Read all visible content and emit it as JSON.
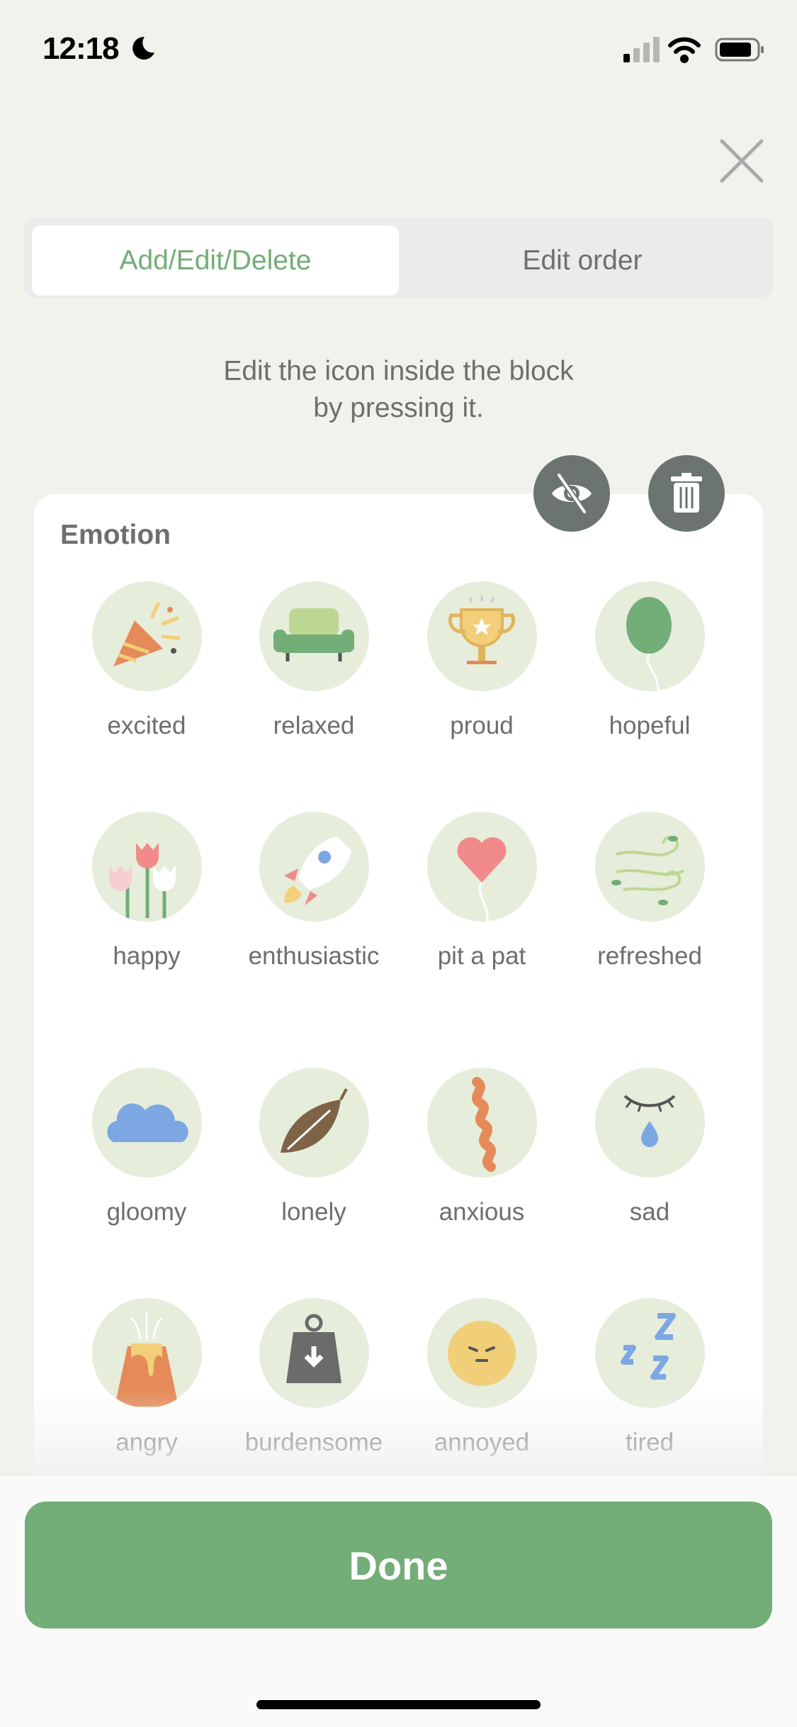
{
  "status_bar": {
    "time": "12:18",
    "icons": [
      "moon-icon",
      "signal-icon",
      "wifi-icon",
      "battery-icon"
    ]
  },
  "tabs": [
    {
      "label": "Add/Edit/Delete",
      "selected": true
    },
    {
      "label": "Edit order",
      "selected": false
    }
  ],
  "hint": {
    "line1": "Edit the icon inside the block",
    "line2": "by pressing it."
  },
  "section": {
    "title": "Emotion",
    "items": [
      {
        "label": "excited",
        "icon": "party-popper-icon"
      },
      {
        "label": "relaxed",
        "icon": "sofa-icon"
      },
      {
        "label": "proud",
        "icon": "trophy-icon"
      },
      {
        "label": "hopeful",
        "icon": "balloon-icon"
      },
      {
        "label": "happy",
        "icon": "tulips-icon"
      },
      {
        "label": "enthusiastic",
        "icon": "rocket-icon"
      },
      {
        "label": "pit a pat",
        "icon": "heart-balloon-icon"
      },
      {
        "label": "refreshed",
        "icon": "wind-icon"
      },
      {
        "label": "gloomy",
        "icon": "cloud-icon"
      },
      {
        "label": "lonely",
        "icon": "leaf-icon"
      },
      {
        "label": "anxious",
        "icon": "twisted-rope-icon"
      },
      {
        "label": "sad",
        "icon": "teardrop-eye-icon"
      },
      {
        "label": "angry",
        "icon": "volcano-icon"
      },
      {
        "label": "burdensome",
        "icon": "weight-icon"
      },
      {
        "label": "annoyed",
        "icon": "annoyed-face-icon"
      },
      {
        "label": "tired",
        "icon": "zzz-icon"
      }
    ]
  },
  "done_label": "Done",
  "colors": {
    "accent": "#73ad78",
    "background": "#f2f2ed",
    "icon_bg": "#e6eddb",
    "action_button": "#6b7470"
  }
}
